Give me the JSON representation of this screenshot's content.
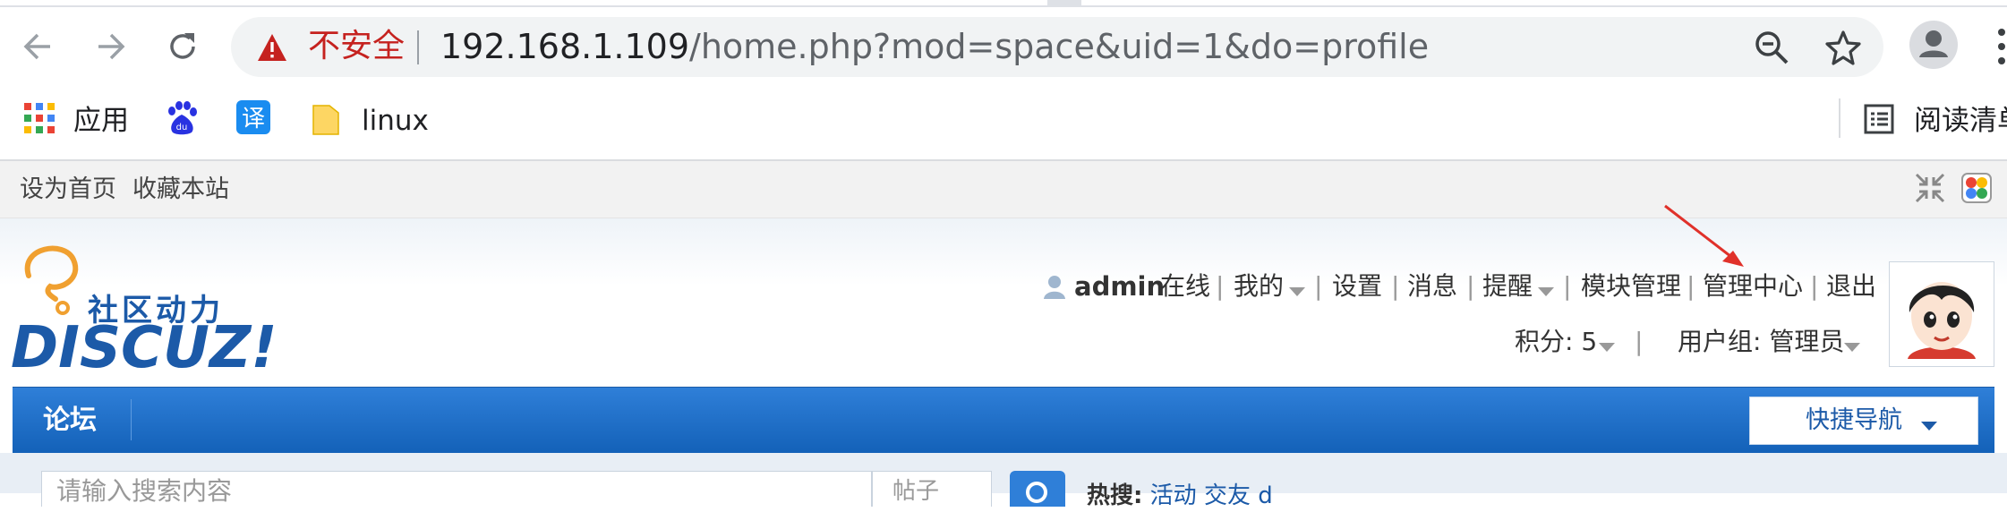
{
  "browser": {
    "security_label": "不安全",
    "url_host": "192.168.1.109",
    "url_path": "/home.php?mod=space&uid=1&do=profile",
    "icons": [
      "back-arrow-icon",
      "forward-arrow-icon",
      "reload-icon",
      "warning-icon",
      "zoom-out-icon",
      "star-icon",
      "profile-icon",
      "more-icon"
    ],
    "bookmarks": [
      {
        "label": "应用",
        "icon": "apps-grid-icon"
      },
      {
        "label": "",
        "icon": "baidu-icon"
      },
      {
        "label": "",
        "icon": "translate-icon"
      },
      {
        "label": "linux",
        "icon": "folder-icon"
      }
    ],
    "reading_list_label": "阅读清单"
  },
  "page": {
    "topbar": {
      "set_home": "设为首页",
      "favorite": "收藏本站"
    },
    "logo": {
      "tagline": "社区动力",
      "brand": "DISCUZ!"
    },
    "user_bar": {
      "username": "admin",
      "status": "在线",
      "links": [
        "我的",
        "设置",
        "消息",
        "提醒",
        "模块管理",
        "管理中心",
        "退出"
      ],
      "points_label": "积分: 5",
      "group_label": "用户组: 管理员"
    },
    "nav": {
      "forum": "论坛",
      "quick_nav": "快捷导航"
    },
    "search": {
      "placeholder": "请输入搜索内容",
      "type": "帖子",
      "hot_label": "热搜:",
      "hot_items": [
        "活动",
        "交友",
        "d"
      ]
    },
    "colors": {
      "nav_blue": "#1e6fc8",
      "warning_red": "#c5221f",
      "arrow_red": "#e0312a"
    }
  }
}
